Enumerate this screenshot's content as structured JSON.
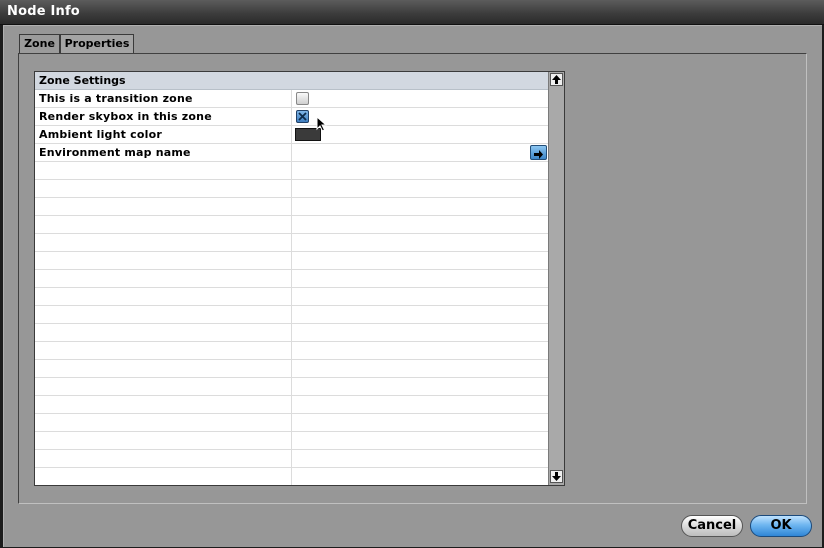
{
  "window": {
    "title": "Node Info"
  },
  "tabs": [
    {
      "label": "Zone",
      "active": true
    },
    {
      "label": "Properties",
      "active": false
    }
  ],
  "grid": {
    "header": "Zone Settings",
    "rows": [
      {
        "label": "This is a transition zone",
        "control": "checkbox",
        "checked": false
      },
      {
        "label": "Render skybox in this zone",
        "control": "checkbox",
        "checked": true
      },
      {
        "label": "Ambient light color",
        "control": "color-swatch",
        "color": "#3a3a3a"
      },
      {
        "label": "Environment map name",
        "control": "browse-button",
        "value": ""
      }
    ],
    "scroll_up_icon": "arrow-up-icon",
    "scroll_down_icon": "arrow-down-icon"
  },
  "buttons": {
    "cancel": "Cancel",
    "ok": "OK"
  },
  "colors": {
    "accent": "#3d86c7",
    "panel": "#979797",
    "header": "#d2d8e0"
  }
}
